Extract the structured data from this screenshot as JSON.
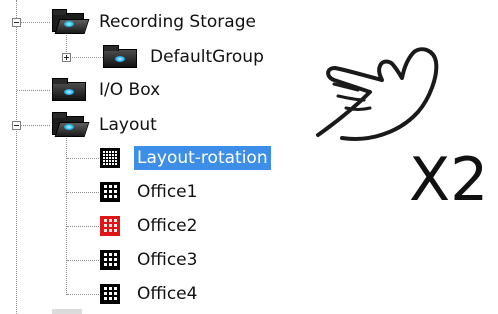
{
  "tree": {
    "items": [
      {
        "label": "Recording Storage",
        "icon": "folder-open-icon"
      },
      {
        "label": "DefaultGroup",
        "icon": "folder-closed-icon"
      },
      {
        "label": "I/O Box",
        "icon": "folder-closed-icon"
      },
      {
        "label": "Layout",
        "icon": "folder-open-icon"
      },
      {
        "label": "Layout-rotation",
        "icon": "layout-grid-icon",
        "selected": true
      },
      {
        "label": "Office1",
        "icon": "layout-grid-icon"
      },
      {
        "label": "Office2",
        "icon": "layout-grid-icon",
        "color": "#e01515"
      },
      {
        "label": "Office3",
        "icon": "layout-grid-icon"
      },
      {
        "label": "Office4",
        "icon": "layout-grid-icon"
      }
    ],
    "selection_color": "#3d8ee6"
  },
  "annotation": {
    "text": "X2",
    "gesture": "hand-pointer-icon"
  }
}
